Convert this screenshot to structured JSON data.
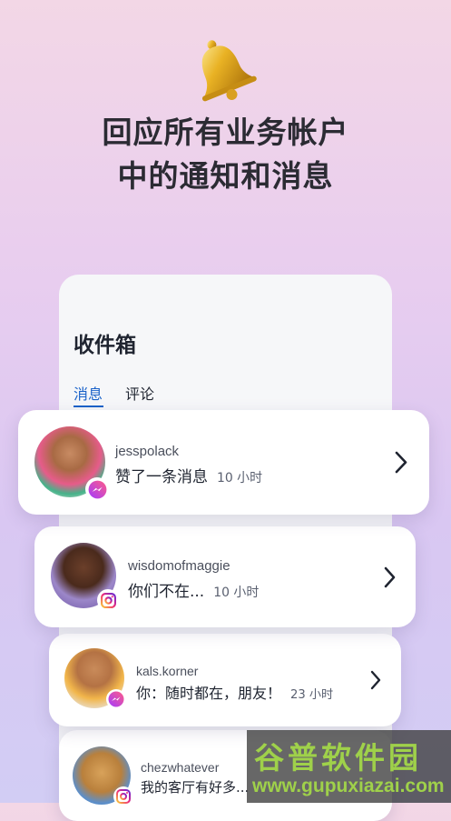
{
  "headline": {
    "line1": "回应所有业务帐户",
    "line2": "中的通知和消息"
  },
  "icons": {
    "bell": "bell-icon",
    "messenger": "messenger-icon",
    "instagram": "instagram-icon",
    "chevron": "chevron-right-icon"
  },
  "inbox": {
    "title": "收件箱",
    "tabs": [
      {
        "label": "消息",
        "active": true
      },
      {
        "label": "评论",
        "active": false
      }
    ],
    "items": [
      {
        "username": "jesspolack",
        "message": "赞了一条消息",
        "time": "10 小时",
        "platform": "messenger"
      },
      {
        "username": "wisdomofmaggie",
        "message": "你们不在...",
        "time": "10 小时",
        "platform": "instagram"
      },
      {
        "username": "kals.korner",
        "message": "你：随时都在，朋友！",
        "time": "23 小时",
        "platform": "messenger"
      },
      {
        "username": "chezwhatever",
        "message": "我的客厅有好多...",
        "time": "",
        "platform": "instagram"
      }
    ]
  },
  "watermark": {
    "name": "谷普软件园",
    "url": "www.gupuxiazai.com"
  },
  "colors": {
    "accent": "#1a62c9",
    "messenger_gradient": [
      "#a33bff",
      "#ff5c87"
    ],
    "instagram_gradient": [
      "#f9ce34",
      "#ee2a7b",
      "#6228d7"
    ]
  }
}
